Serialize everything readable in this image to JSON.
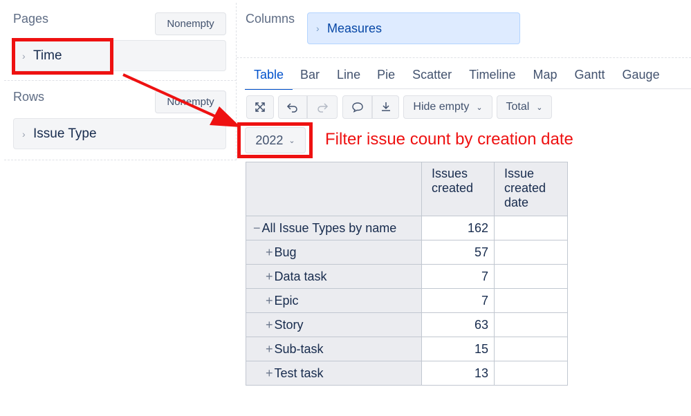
{
  "pages": {
    "title": "Pages",
    "nonempty_label": "Nonempty",
    "dimension": "Time"
  },
  "rows": {
    "title": "Rows",
    "nonempty_label": "Nonempty",
    "dimension": "Issue Type"
  },
  "columns": {
    "title": "Columns",
    "dimension": "Measures"
  },
  "tabs": [
    "Table",
    "Bar",
    "Line",
    "Pie",
    "Scatter",
    "Timeline",
    "Map",
    "Gantt",
    "Gauge"
  ],
  "active_tab": "Table",
  "toolbar": {
    "hide_empty_label": "Hide empty",
    "total_label": "Total"
  },
  "year_selector": {
    "value": "2022"
  },
  "annotation": {
    "text": "Filter issue count by creation date",
    "color": "#ee1111"
  },
  "table": {
    "headers": [
      "Issues created",
      "Issue created date"
    ],
    "header_lines": [
      [
        "Issues",
        "created"
      ],
      [
        "Issue",
        "created",
        "date"
      ]
    ],
    "rows": [
      {
        "sign": "−",
        "label": "All Issue Types by name",
        "issues_created": "162",
        "created_date": ""
      },
      {
        "sign": "+",
        "label": "Bug",
        "issues_created": "57",
        "created_date": ""
      },
      {
        "sign": "+",
        "label": "Data task",
        "issues_created": "7",
        "created_date": ""
      },
      {
        "sign": "+",
        "label": "Epic",
        "issues_created": "7",
        "created_date": ""
      },
      {
        "sign": "+",
        "label": "Story",
        "issues_created": "63",
        "created_date": ""
      },
      {
        "sign": "+",
        "label": "Sub-task",
        "issues_created": "15",
        "created_date": ""
      },
      {
        "sign": "+",
        "label": "Test task",
        "issues_created": "13",
        "created_date": ""
      }
    ]
  }
}
